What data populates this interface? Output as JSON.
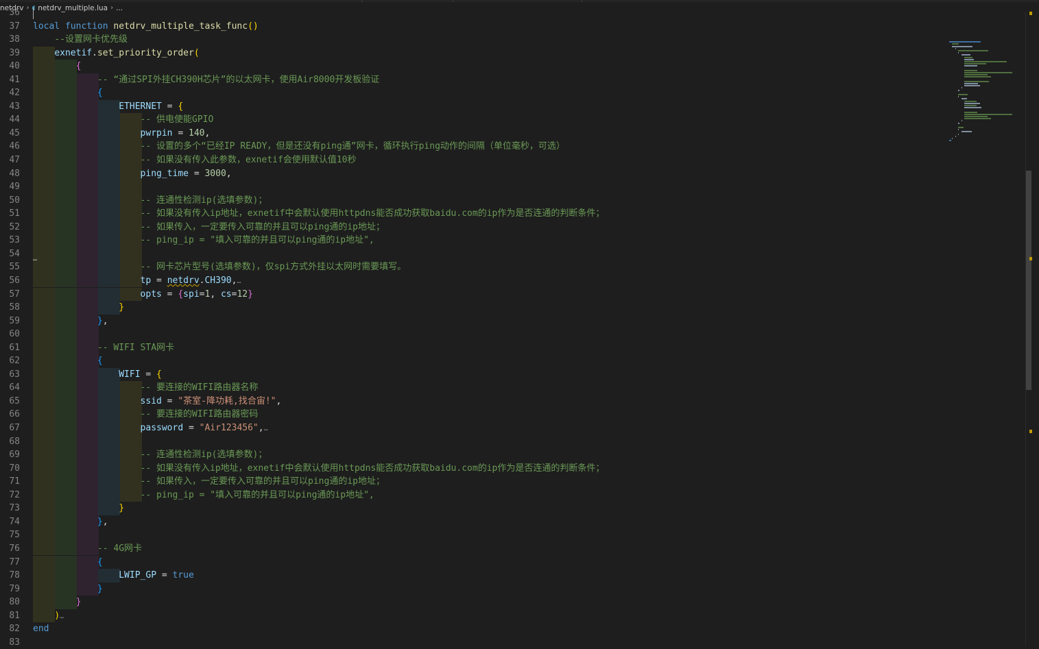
{
  "breadcrumb": {
    "folder": "netdrv",
    "file_icon": "lua-file-icon",
    "file": "netdrv_multiple.lua",
    "trail": "..."
  },
  "lines": [
    {
      "n": "36",
      "text": ""
    },
    {
      "n": "37",
      "text": "local function netdrv_multiple_task_func()"
    },
    {
      "n": "38",
      "text": "    --设置网卡优先级"
    },
    {
      "n": "39",
      "text": "    exnetif.set_priority_order("
    },
    {
      "n": "40",
      "text": "        {"
    },
    {
      "n": "41",
      "text": "            -- “通过SPI外挂CH390H芯片”的以太网卡，使用Air8000开发板验证"
    },
    {
      "n": "42",
      "text": "            {"
    },
    {
      "n": "43",
      "text": "                ETHERNET = {"
    },
    {
      "n": "44",
      "text": "                    -- 供电使能GPIO"
    },
    {
      "n": "45",
      "text": "                    pwrpin = 140,"
    },
    {
      "n": "46",
      "text": "                    -- 设置的多个“已经IP READY，但是还没有ping通”网卡，循环执行ping动作的间隔（单位毫秒，可选）"
    },
    {
      "n": "47",
      "text": "                    -- 如果没有传入此参数，exnetif会使用默认值10秒"
    },
    {
      "n": "48",
      "text": "                    ping_time = 3000,"
    },
    {
      "n": "49",
      "text": ""
    },
    {
      "n": "50",
      "text": "                    -- 连通性检测ip(选填参数)；"
    },
    {
      "n": "51",
      "text": "                    -- 如果没有传入ip地址，exnetif中会默认使用httpdns能否成功获取baidu.com的ip作为是否连通的判断条件；"
    },
    {
      "n": "52",
      "text": "                    -- 如果传入，一定要传入可靠的并且可以ping通的ip地址；"
    },
    {
      "n": "53",
      "text": "                    -- ping_ip = \"填入可靠的并且可以ping通的ip地址\","
    },
    {
      "n": "54",
      "text": ""
    },
    {
      "n": "55",
      "text": "                    -- 网卡芯片型号(选填参数)，仅spi方式外挂以太网时需要填写。"
    },
    {
      "n": "56",
      "text": "                    tp = netdrv.CH390,"
    },
    {
      "n": "57",
      "text": "                    opts = {spi=1, cs=12}"
    },
    {
      "n": "58",
      "text": "                }"
    },
    {
      "n": "59",
      "text": "            },"
    },
    {
      "n": "60",
      "text": ""
    },
    {
      "n": "61",
      "text": "            -- WIFI STA网卡"
    },
    {
      "n": "62",
      "text": "            {"
    },
    {
      "n": "63",
      "text": "                WIFI = {"
    },
    {
      "n": "64",
      "text": "                    -- 要连接的WIFI路由器名称"
    },
    {
      "n": "65",
      "text": "                    ssid = \"茶室-降功耗,找合宙!\","
    },
    {
      "n": "66",
      "text": "                    -- 要连接的WIFI路由器密码"
    },
    {
      "n": "67",
      "text": "                    password = \"Air123456\","
    },
    {
      "n": "68",
      "text": ""
    },
    {
      "n": "69",
      "text": "                    -- 连通性检测ip(选填参数)；"
    },
    {
      "n": "70",
      "text": "                    -- 如果没有传入ip地址，exnetif中会默认使用httpdns能否成功获取baidu.com的ip作为是否连通的判断条件；"
    },
    {
      "n": "71",
      "text": "                    -- 如果传入，一定要传入可靠的并且可以ping通的ip地址；"
    },
    {
      "n": "72",
      "text": "                    -- ping_ip = \"填入可靠的并且可以ping通的ip地址\","
    },
    {
      "n": "73",
      "text": "                }"
    },
    {
      "n": "74",
      "text": "            },"
    },
    {
      "n": "75",
      "text": ""
    },
    {
      "n": "76",
      "text": "            -- 4G网卡"
    },
    {
      "n": "77",
      "text": "            {"
    },
    {
      "n": "78",
      "text": "                LWIP_GP = true"
    },
    {
      "n": "79",
      "text": "            }"
    },
    {
      "n": "80",
      "text": "        }"
    },
    {
      "n": "81",
      "text": "    )"
    },
    {
      "n": "82",
      "text": "end"
    },
    {
      "n": "83",
      "text": ""
    }
  ],
  "guides": {
    "39": 1,
    "40": 2,
    "41": 3,
    "42": 3,
    "43": 4,
    "44": 5,
    "45": 5,
    "46": 5,
    "47": 5,
    "48": 5,
    "49": 5,
    "50": 5,
    "51": 5,
    "52": 5,
    "53": 5,
    "54": 5,
    "55": 5,
    "56": 5,
    "57": 5,
    "58": 4,
    "59": 3,
    "60": 3,
    "61": 3,
    "62": 3,
    "63": 4,
    "64": 5,
    "65": 5,
    "66": 5,
    "67": 5,
    "68": 5,
    "69": 5,
    "70": 5,
    "71": 5,
    "72": 5,
    "73": 4,
    "74": 3,
    "75": 3,
    "76": 3,
    "77": 3,
    "78": 4,
    "79": 3,
    "80": 2,
    "81": 1
  },
  "colors": {
    "background": "#1e1e1e",
    "keyword": "#569cd6",
    "control": "#c586c0",
    "function": "#dcdcaa",
    "variable": "#9cdcfe",
    "number": "#b5cea8",
    "string": "#ce9178",
    "comment": "#6a9955",
    "bracket1": "#ffd700",
    "bracket2": "#da70d6",
    "bracket3": "#179fff",
    "warning": "#cca700"
  },
  "icons": {
    "fold": "fold-ellipsis-icon",
    "chevron": "chevron-right-icon"
  }
}
